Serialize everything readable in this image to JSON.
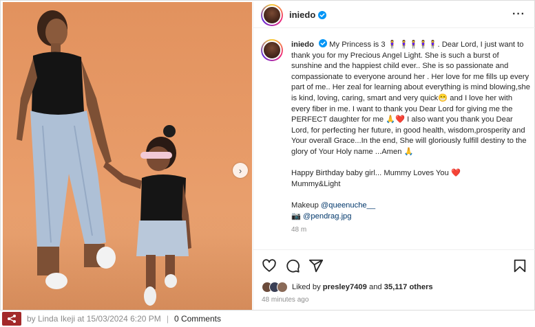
{
  "post": {
    "username": "iniedo",
    "more_label": "···",
    "next_label": "›"
  },
  "caption": {
    "username": "iniedo",
    "line1": "My Princess is 3 ",
    "line1_emojis": "🧍‍♀️ 🧍‍♀️🧍‍♀️🧍‍♀️🧍‍♀️",
    "line1_rest": ". Dear Lord, I just want to thank you for my Precious Angel Light. She is such a burst of sunshine and the happiest child ever.. She is so passionate and compassionate to everyone around her . Her love for me fills up every part of me.. Her zeal for learning about everything is mind blowing,she is kind, loving, caring, smart and very quick😁 and I love her with every fiber in me. I want to thank you Dear Lord for giving me the PERFECT daughter for me 🙏❤️ I also want you thank you Dear Lord, for perfecting her future, in good health, wisdom,prosperity and Your overall Grace...In the end, She will gloriously fulfill destiny to the glory of Your Holy name ...Amen 🙏",
    "birthday_line": "Happy Birthday baby girl... Mummy Loves You ❤️",
    "signature": "Mummy&Light",
    "makeup_label": "Makeup ",
    "makeup_mention": "@queenuche__",
    "photo_prefix": "📷 ",
    "photo_mention": "@pendrag.jpg",
    "time_ago": "48 m"
  },
  "engagement": {
    "liked_by_prefix": "Liked by ",
    "liked_by_user": "presley7409",
    "and_label": " and ",
    "others_count": "35,117 others",
    "posted_ago": "48 minutes ago"
  },
  "footer": {
    "by_label": "by Linda Ikeji at 15/03/2024 6:20 PM",
    "separator": "|",
    "comments_label": "0 Comments"
  },
  "colors": {
    "verified_blue": "#0095f6",
    "mention_blue": "#00376b",
    "share_red": "#a3292a",
    "photo_bg": "#e79a67"
  },
  "icons": [
    "verified-badge-icon",
    "more-options-icon",
    "heart-icon",
    "comment-icon",
    "share-icon",
    "bookmark-icon",
    "next-arrow-icon",
    "share-footer-icon"
  ]
}
